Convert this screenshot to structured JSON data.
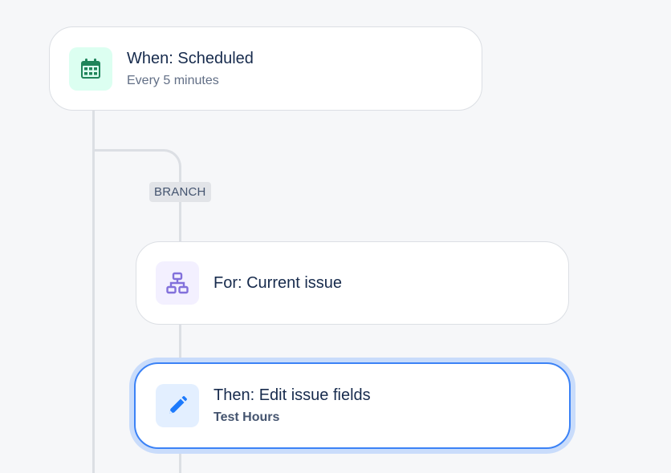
{
  "trigger": {
    "title": "When: Scheduled",
    "subtitle": "Every 5 minutes",
    "icon": "calendar-icon",
    "icon_color": "#1f845a",
    "tile_color": "#dcfff1"
  },
  "branch_label": "BRANCH",
  "branch": {
    "title": "For: Current issue",
    "icon": "hierarchy-icon",
    "icon_color": "#8270db",
    "tile_color": "#f3f0ff"
  },
  "action": {
    "title": "Then: Edit issue fields",
    "subtitle": "Test Hours",
    "icon": "pencil-icon",
    "icon_color": "#1d7afc",
    "tile_color": "#e3efff",
    "selected": true,
    "accent": "#3b82f6"
  }
}
